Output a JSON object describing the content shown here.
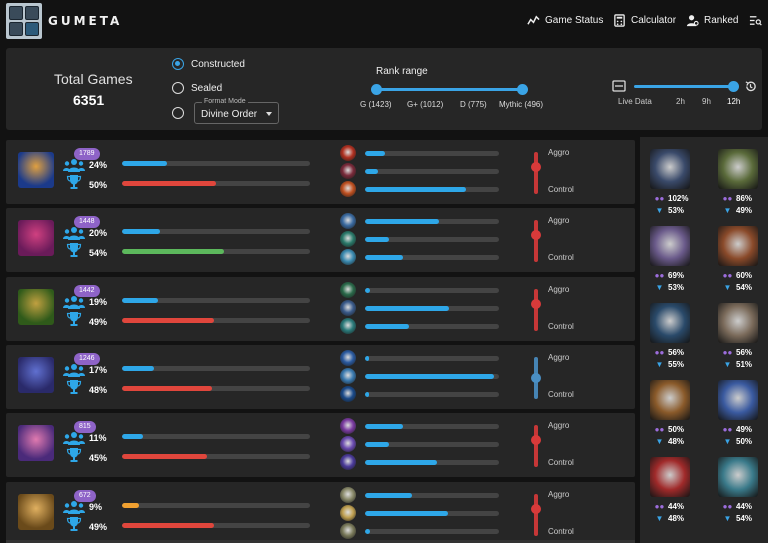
{
  "header": {
    "brand": "GUMETA",
    "nav": [
      {
        "label": "Game Status",
        "icon": "chart-line-icon"
      },
      {
        "label": "Calculator",
        "icon": "calculator-icon"
      },
      {
        "label": "Ranked",
        "icon": "ranked-user-icon"
      }
    ]
  },
  "filters": {
    "total_label": "Total Games",
    "total_value": "6351",
    "modes": [
      {
        "label": "Constructed",
        "selected": true
      },
      {
        "label": "Sealed",
        "selected": false
      }
    ],
    "format_legend": "Format Mode",
    "format_value": "Divine Order",
    "rank_title": "Rank range",
    "ranks": [
      "G (1423)",
      "G+ (1012)",
      "D (775)",
      "Mythic (496)"
    ],
    "times": [
      "Live Data",
      "2h",
      "9h",
      "12h"
    ],
    "time_selected": "12h"
  },
  "decks": [
    {
      "count": "1789",
      "play": "24%",
      "win": "50%",
      "play_frac": 0.24,
      "win_frac": 0.5,
      "win_color": "#e0463c",
      "cards": [
        0.15,
        0.1,
        0.75
      ],
      "vs_top": "Aggro",
      "vs_bot": "Control",
      "vs_pos": 0.35,
      "vs_color": "#d83a3a"
    },
    {
      "count": "1448",
      "play": "20%",
      "win": "54%",
      "play_frac": 0.2,
      "win_frac": 0.54,
      "win_color": "#5cb85c",
      "cards": [
        0.55,
        0.18,
        0.28
      ],
      "vs_top": "Aggro",
      "vs_bot": "Control",
      "vs_pos": 0.35,
      "vs_color": "#d83a3a"
    },
    {
      "count": "1442",
      "play": "19%",
      "win": "49%",
      "play_frac": 0.19,
      "win_frac": 0.49,
      "win_color": "#e0463c",
      "cards": [
        0.04,
        0.63,
        0.33
      ],
      "vs_top": "Aggro",
      "vs_bot": "Control",
      "vs_pos": 0.35,
      "vs_color": "#d83a3a"
    },
    {
      "count": "1246",
      "play": "17%",
      "win": "48%",
      "play_frac": 0.17,
      "win_frac": 0.48,
      "win_color": "#e0463c",
      "cards": [
        0.03,
        0.96,
        0.03
      ],
      "vs_top": "Aggro",
      "vs_bot": "Control",
      "vs_pos": 0.5,
      "vs_color": "#4a8fc4"
    },
    {
      "count": "815",
      "play": "11%",
      "win": "45%",
      "play_frac": 0.11,
      "win_frac": 0.45,
      "win_color": "#e0463c",
      "cards": [
        0.28,
        0.18,
        0.54
      ],
      "vs_top": "Aggro",
      "vs_bot": "Control",
      "vs_pos": 0.35,
      "vs_color": "#d83a3a"
    },
    {
      "count": "672",
      "play": "9%",
      "win": "49%",
      "play_frac": 0.09,
      "win_frac": 0.49,
      "win_color": "#e0463c",
      "play_color": "#f0a030",
      "cards": [
        0.35,
        0.62,
        0.04
      ],
      "vs_top": "Aggro",
      "vs_bot": "Control",
      "vs_pos": 0.35,
      "vs_color": "#d83a3a"
    }
  ],
  "sidebar_cards": [
    {
      "play": "102%",
      "win": "53%"
    },
    {
      "play": "86%",
      "win": "49%"
    },
    {
      "play": "69%",
      "win": "53%"
    },
    {
      "play": "60%",
      "win": "54%"
    },
    {
      "play": "56%",
      "win": "55%"
    },
    {
      "play": "56%",
      "win": "51%"
    },
    {
      "play": "50%",
      "win": "48%"
    },
    {
      "play": "49%",
      "win": "50%"
    },
    {
      "play": "44%",
      "win": "48%"
    },
    {
      "play": "44%",
      "win": "54%"
    }
  ],
  "colors": {
    "accent": "#3aa4e6",
    "panel": "#262626",
    "background": "#121212",
    "badge": "#8e63c7"
  }
}
